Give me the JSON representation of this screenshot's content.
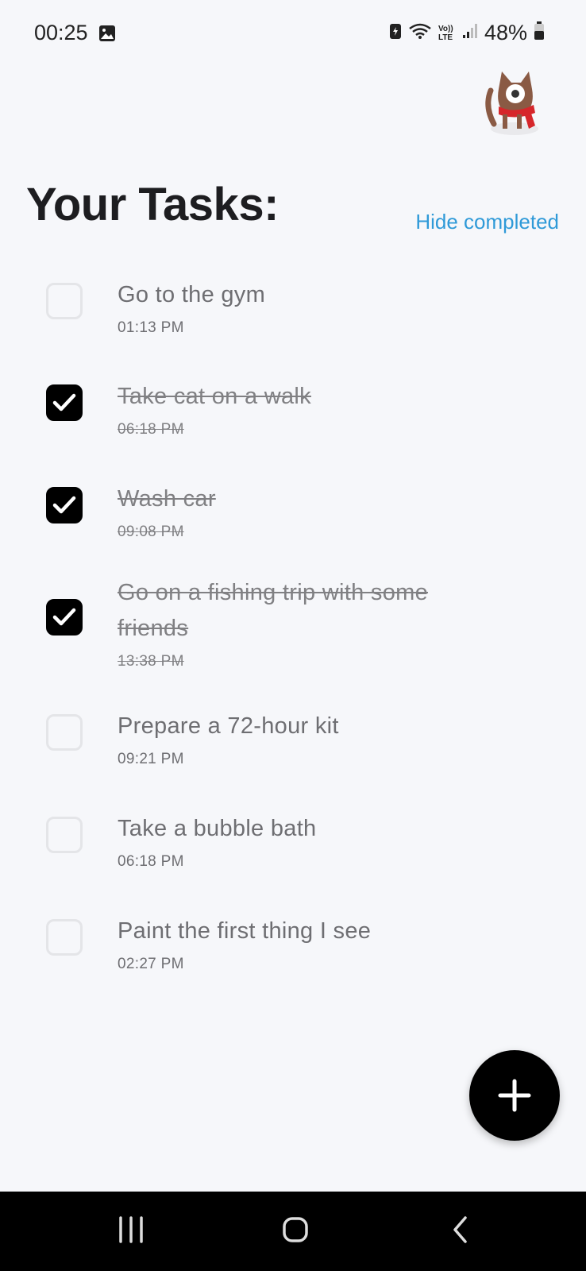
{
  "status_bar": {
    "time": "00:25",
    "battery_percent": "48%",
    "icons": [
      "gallery-icon",
      "battery-saver-icon",
      "wifi-icon",
      "volte-lte-icon",
      "signal-icon",
      "battery-icon"
    ],
    "volte_label": "Vo)) LTE"
  },
  "header": {
    "title": "Your Tasks:",
    "hide_completed": "Hide completed"
  },
  "tasks": [
    {
      "title": "Go to the gym",
      "time": "01:13 PM",
      "completed": false
    },
    {
      "title": "Take cat on a walk",
      "time": "06:18 PM",
      "completed": true
    },
    {
      "title": "Wash car",
      "time": "09:08 PM",
      "completed": true
    },
    {
      "title": "Go on a fishing trip with some friends",
      "time": "13:38 PM",
      "completed": true
    },
    {
      "title": "Prepare a 72-hour kit",
      "time": "09:21 PM",
      "completed": false
    },
    {
      "title": "Take a bubble bath",
      "time": "06:18 PM",
      "completed": false
    },
    {
      "title": "Paint the first thing I see",
      "time": "02:27 PM",
      "completed": false
    }
  ],
  "fab": {
    "icon": "plus-icon"
  },
  "nav": {
    "icons": [
      "recents-icon",
      "home-icon",
      "back-icon"
    ]
  },
  "colors": {
    "accent": "#2f9ad8",
    "checkbox_checked": "#000000",
    "background": "#f6f7fa"
  }
}
